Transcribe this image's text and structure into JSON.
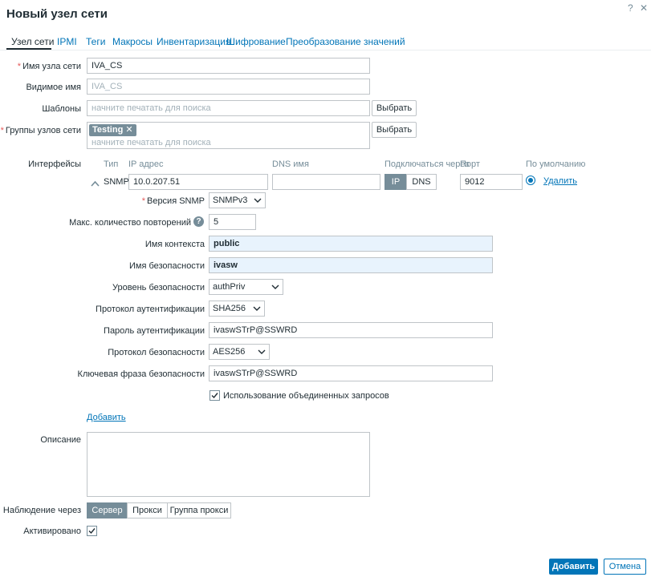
{
  "dialog": {
    "title": "Новый узел сети",
    "help_glyph": "?",
    "close_glyph": "✕"
  },
  "tabs": [
    {
      "label": "Узел сети",
      "active": true
    },
    {
      "label": "IPMI"
    },
    {
      "label": "Теги"
    },
    {
      "label": "Макросы"
    },
    {
      "label": "Инвентаризация"
    },
    {
      "label": "Шифрование"
    },
    {
      "label": "Преобразование значений"
    }
  ],
  "host": {
    "hostname_label": "Имя узла сети",
    "hostname_value": "IVA_CS",
    "visible_label": "Видимое имя",
    "visible_value": "IVA_CS",
    "templates_label": "Шаблоны",
    "templates_placeholder": "начните печатать для поиска",
    "select_label": "Выбрать",
    "groups_label": "Группы узлов сети",
    "groups_tag": "Testing",
    "groups_tag_remove": "✕",
    "groups_placeholder": "начните печатать для поиска",
    "required_mark": "*"
  },
  "interfaces": {
    "label": "Интерфейсы",
    "headers": {
      "type": "Тип",
      "ip": "IP адрес",
      "dns": "DNS имя",
      "connect": "Подключаться через",
      "port": "Порт",
      "default": "По умолчанию"
    },
    "type": "SNMP",
    "ip_value": "10.0.207.51",
    "dns_value": "",
    "connect_ip": "IP",
    "connect_dns": "DNS",
    "port_value": "9012",
    "remove_label": "Удалить",
    "add_label": "Добавить"
  },
  "snmp": {
    "version_label": "Версия SNMP",
    "version_value": "SNMPv3",
    "max_rep_label": "Макс. количество повторений",
    "max_rep_value": "5",
    "context_label": "Имя контекста",
    "context_value": "public",
    "security_name_label": "Имя безопасности",
    "security_name_value": "ivasw",
    "security_level_label": "Уровень безопасности",
    "security_level_value": "authPriv",
    "auth_protocol_label": "Протокол аутентификации",
    "auth_protocol_value": "SHA256",
    "auth_pass_label": "Пароль аутентификации",
    "auth_pass_value": "ivaswSTrP@SSWRD",
    "priv_protocol_label": "Протокол безопасности",
    "priv_protocol_value": "AES256",
    "priv_pass_label": "Ключевая фраза безопасности",
    "priv_pass_value": "ivaswSTrP@SSWRD",
    "bulk_label": "Использование объединенных запросов",
    "bulk_checked": true
  },
  "description": {
    "label": "Описание",
    "value": ""
  },
  "monitoring": {
    "label": "Наблюдение через",
    "options": [
      "Сервер",
      "Прокси",
      "Группа прокси"
    ],
    "selected": "Сервер"
  },
  "enabled": {
    "label": "Активировано",
    "checked": true
  },
  "footer": {
    "add_label": "Добавить",
    "cancel_label": "Отмена"
  },
  "colors": {
    "accent": "#0275b8",
    "required": "#e45959",
    "segment_active": "#768d99",
    "filled_field": "#e8f3fd"
  }
}
